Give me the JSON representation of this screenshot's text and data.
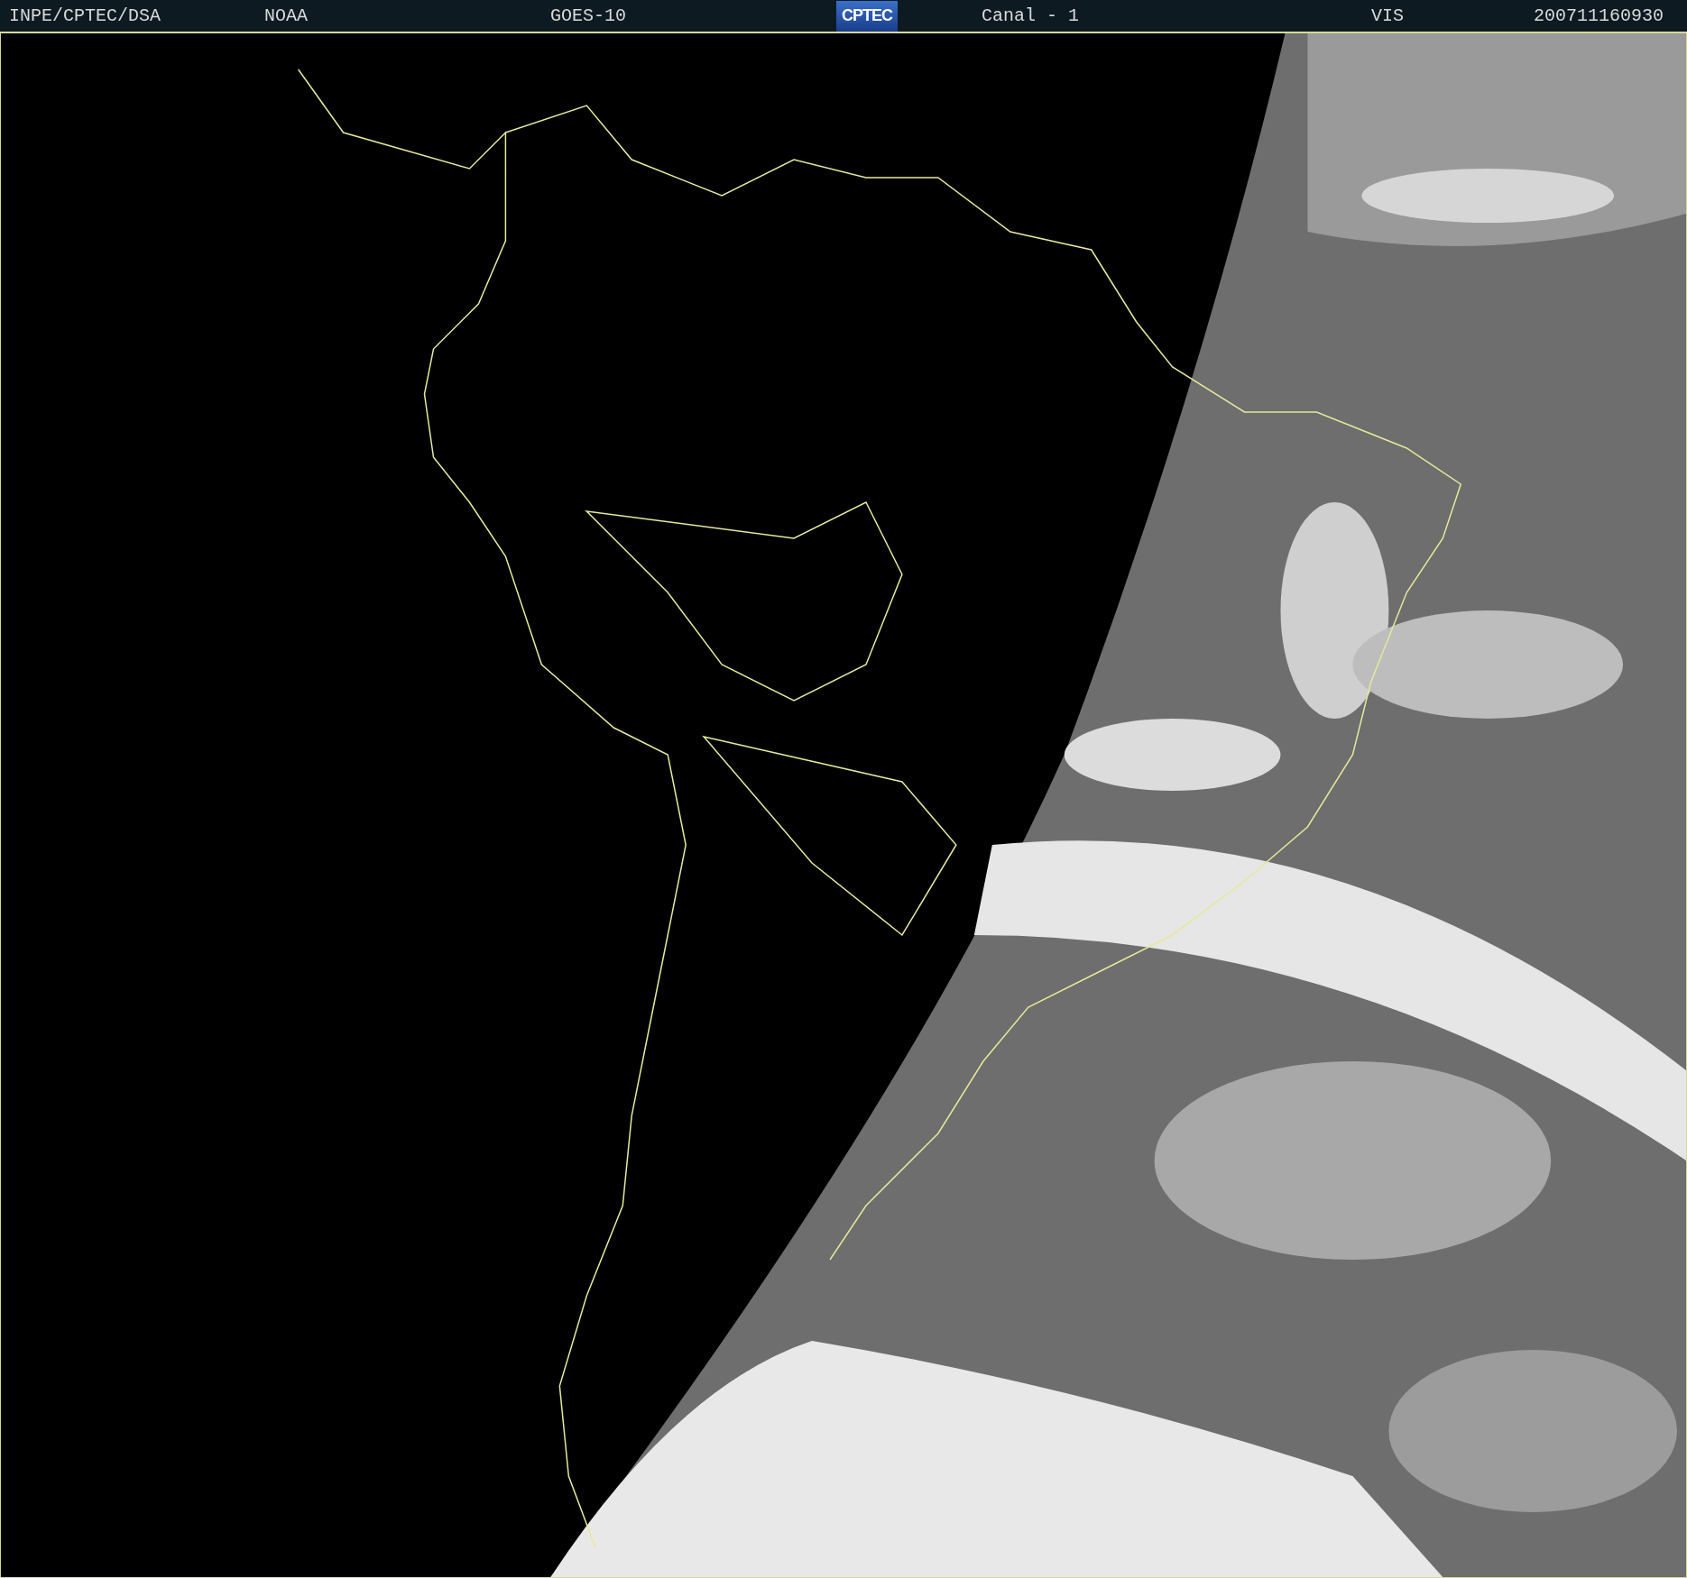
{
  "header": {
    "items": [
      {
        "kind": "text",
        "text": "INPE/CPTEC/DSA"
      },
      {
        "kind": "text",
        "text": "NOAA"
      },
      {
        "kind": "text",
        "text": "GOES-10"
      },
      {
        "kind": "logo",
        "text": "CPTEC"
      },
      {
        "kind": "text",
        "text": "Canal - 1"
      },
      {
        "kind": "text",
        "text": "VIS"
      },
      {
        "kind": "text",
        "text": "200711160930"
      }
    ]
  }
}
